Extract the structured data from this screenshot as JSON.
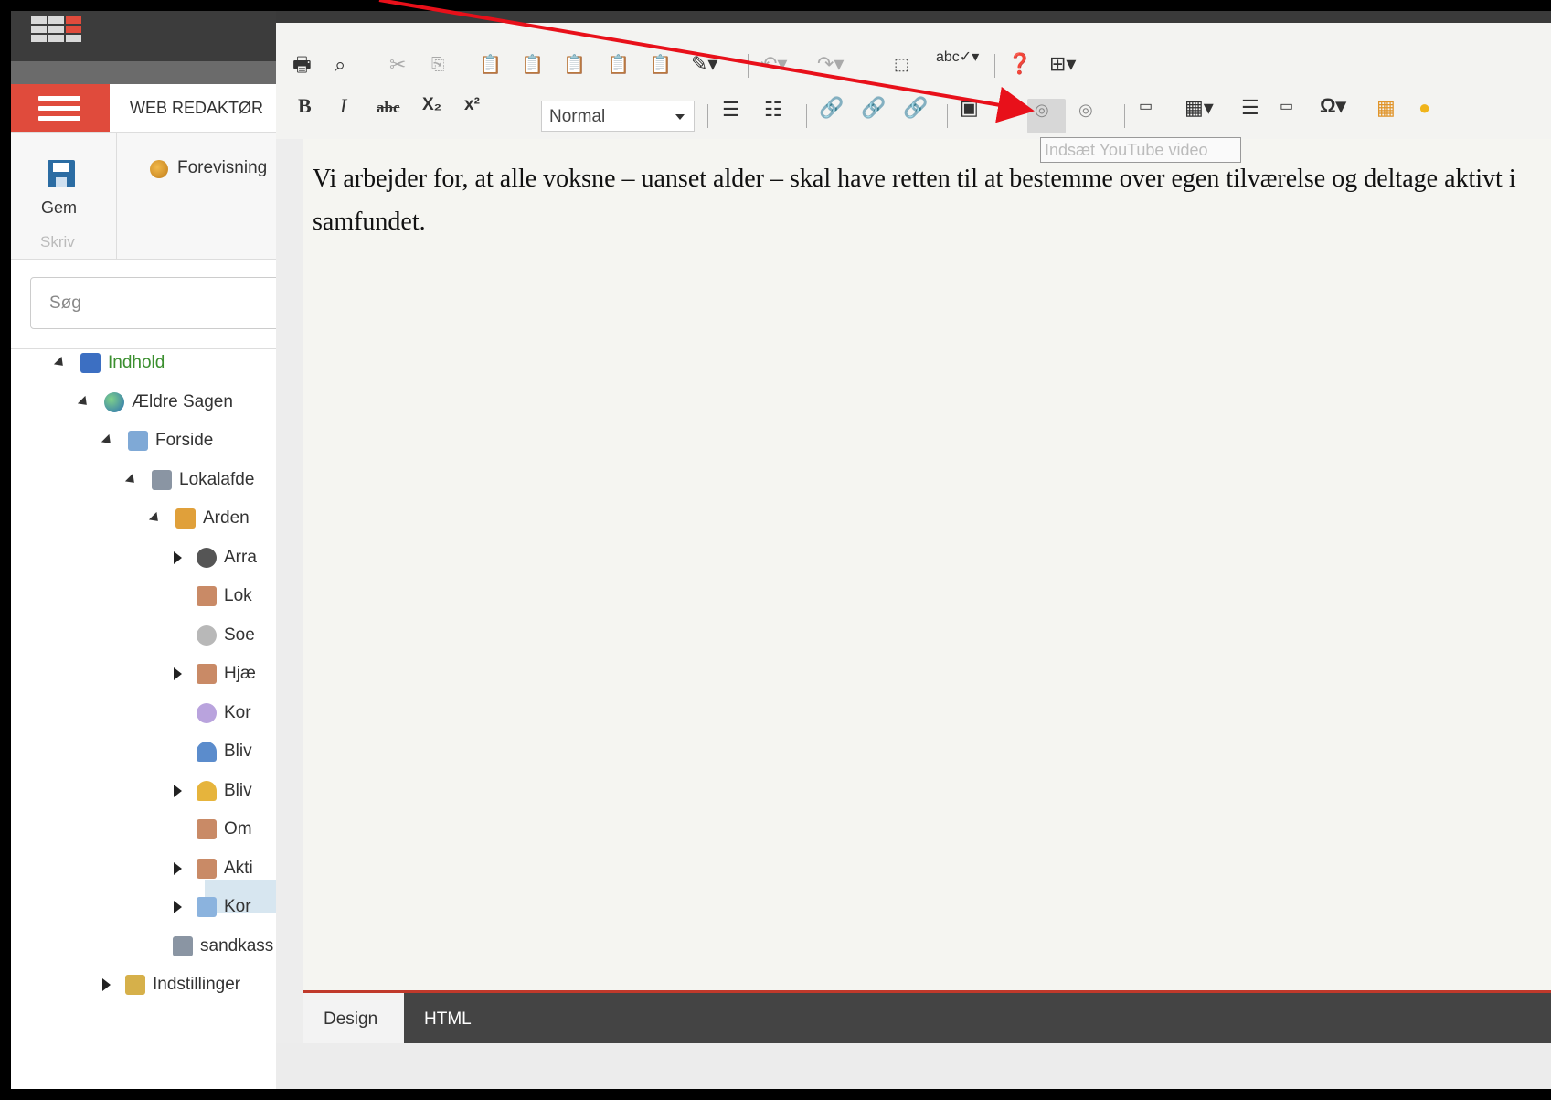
{
  "app": {
    "nav_title": "WEB REDAKTØR",
    "save_label": "Gem",
    "group_label": "Skriv",
    "preview_label": "Forevisning",
    "search_placeholder": "Søg"
  },
  "tree": [
    {
      "label": "Indhold",
      "icon": "content-icon",
      "color": "#3b8f2f"
    },
    {
      "label": "Ældre Sagen",
      "icon": "globe-icon",
      "color": "#333333"
    },
    {
      "label": "Forside",
      "icon": "home-page-icon",
      "color": "#333333"
    },
    {
      "label": "Lokalafde",
      "icon": "database-icon",
      "color": "#333333"
    },
    {
      "label": "Arden",
      "icon": "house-icon",
      "color": "#333333"
    },
    {
      "label": "Arra",
      "icon": "football-icon",
      "color": "#333333"
    },
    {
      "label": "Lok",
      "icon": "document-icon",
      "color": "#333333"
    },
    {
      "label": "Soe",
      "icon": "handshake-icon",
      "color": "#333333"
    },
    {
      "label": "Hjæ",
      "icon": "document-icon",
      "color": "#333333"
    },
    {
      "label": "Kor",
      "icon": "speech-bubble-icon",
      "color": "#333333"
    },
    {
      "label": "Bliv",
      "icon": "person-icon",
      "color": "#333333"
    },
    {
      "label": "Bliv",
      "icon": "person-group-icon",
      "color": "#333333"
    },
    {
      "label": "Om",
      "icon": "document-icon",
      "color": "#333333"
    },
    {
      "label": "Akti",
      "icon": "document-icon",
      "color": "#333333"
    },
    {
      "label": "Kor",
      "icon": "folder-icon",
      "color": "#333333"
    },
    {
      "label": "sandkass",
      "icon": "database-icon",
      "color": "#333333"
    },
    {
      "label": "Indstillinger",
      "icon": "settings-folder-icon",
      "color": "#333333"
    }
  ],
  "editor": {
    "format_select": "Normal",
    "tooltip": "Indsæt YouTube video",
    "content": "Vi arbejder for, at alle voksne – uanset alder – skal have retten til at bestemme over egen tilværelse og deltage aktivt i samfundet.",
    "tabs": {
      "design": "Design",
      "html": "HTML"
    },
    "toolbar_text": {
      "bold": "B",
      "italic": "I",
      "strike": "abc",
      "sub": "X₂",
      "sup": "x²",
      "omega": "Ω",
      "spell": "abc"
    }
  },
  "colors": {
    "accent": "#e04b3c",
    "arrow": "#e8101a",
    "selection": "#d7e6f0",
    "dark": "#3a3a3a"
  }
}
